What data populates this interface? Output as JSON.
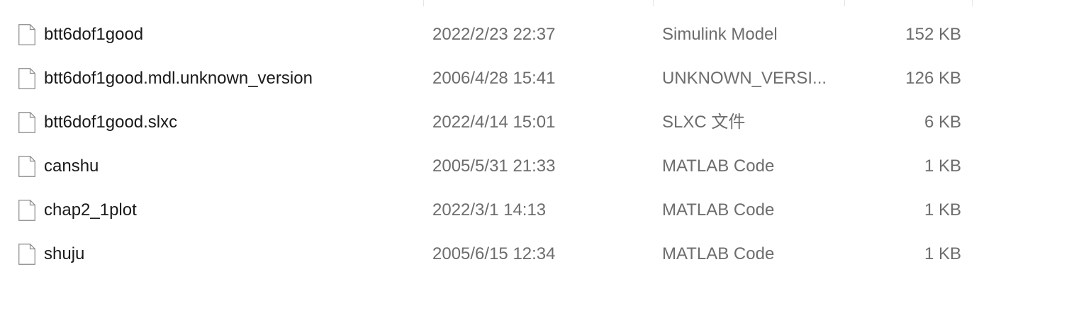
{
  "files": [
    {
      "name": "btt6dof1good",
      "date": "2022/2/23 22:37",
      "type": "Simulink Model",
      "size": "152 KB",
      "icon": "file-icon"
    },
    {
      "name": "btt6dof1good.mdl.unknown_version",
      "date": "2006/4/28 15:41",
      "type": "UNKNOWN_VERSI...",
      "size": "126 KB",
      "icon": "file-icon"
    },
    {
      "name": "btt6dof1good.slxc",
      "date": "2022/4/14 15:01",
      "type": "SLXC 文件",
      "size": "6 KB",
      "icon": "file-icon"
    },
    {
      "name": "canshu",
      "date": "2005/5/31 21:33",
      "type": "MATLAB Code",
      "size": "1 KB",
      "icon": "file-icon"
    },
    {
      "name": "chap2_1plot",
      "date": "2022/3/1 14:13",
      "type": "MATLAB Code",
      "size": "1 KB",
      "icon": "file-icon"
    },
    {
      "name": "shuju",
      "date": "2005/6/15 12:34",
      "type": "MATLAB Code",
      "size": "1 KB",
      "icon": "file-icon"
    }
  ],
  "colors": {
    "name_text": "#1a1a1a",
    "meta_text": "#6d6d6d",
    "divider": "#e5e5e5",
    "icon_stroke": "#8a8a8a"
  }
}
